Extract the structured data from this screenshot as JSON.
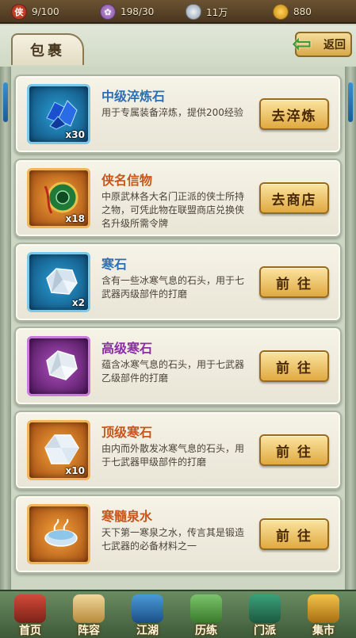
{
  "topbar": {
    "stamina": "9/100",
    "energy": "198/30",
    "silver": "11万",
    "gold": "880"
  },
  "header": {
    "tab_label": "包裹",
    "back_label": "返回"
  },
  "items": [
    {
      "name": "中级淬炼石",
      "desc": "用于专属装备淬炼，提供200经验",
      "count": "x30",
      "action": "去淬炼",
      "frame": "blue"
    },
    {
      "name": "侠名信物",
      "desc": "中原武林各大名门正派的侠士所持之物，可凭此物在联盟商店兑换侠名升级所需令牌",
      "count": "x18",
      "action": "去商店",
      "frame": "orange"
    },
    {
      "name": "寒石",
      "desc": "含有一些冰寒气息的石头，用于七武器丙级部件的打磨",
      "count": "x2",
      "action": "前 往",
      "frame": "blue"
    },
    {
      "name": "高级寒石",
      "desc": "蕴含冰寒气息的石头，用于七武器乙级部件的打磨",
      "count": "",
      "action": "前 往",
      "frame": "purple"
    },
    {
      "name": "顶级寒石",
      "desc": "由内而外散发冰寒气息的石头，用于七武器甲级部件的打磨",
      "count": "x10",
      "action": "前 往",
      "frame": "orange"
    },
    {
      "name": "寒髓泉水",
      "desc": "天下第一寒泉之水，传言其是锻造七武器的必备材料之一",
      "count": "",
      "action": "前 往",
      "frame": "orange"
    }
  ],
  "nav": {
    "home": "首页",
    "lineup": "阵容",
    "jianghu": "江湖",
    "training": "历练",
    "sect": "门派",
    "market": "集市"
  },
  "colors": {
    "blue_name": "#2b6fb6",
    "orange_name": "#c8561a",
    "purple_name": "#8a2ea3",
    "button_gold": "#e0a940"
  }
}
